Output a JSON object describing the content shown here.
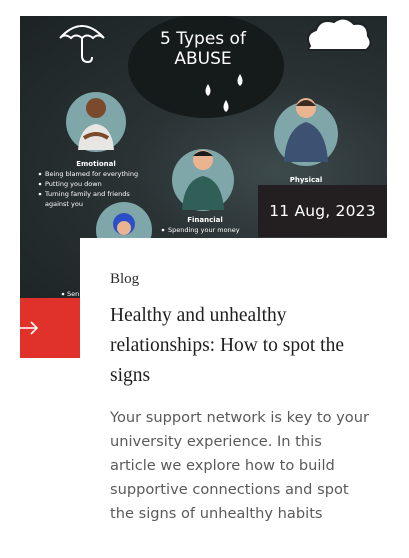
{
  "card": {
    "date": "11 Aug, 2023",
    "category": "Blog",
    "title": "Healthy and unhealthy relationships: How to spot the signs",
    "excerpt": "Your support network is key to your university experience. In this article we explore how to build supportive connections and spot the signs of unhealthy habits",
    "arrow_icon": "arrow-right-icon"
  },
  "infographic": {
    "heading_line1": "5 Types of",
    "heading_line2": "ABUSE",
    "emotional": {
      "label": "Emotional",
      "bullets": [
        "Being blamed for everything",
        "Putting you down",
        "Turning family and friends",
        "against you"
      ]
    },
    "financial": {
      "label": "Financial",
      "bullet": "Spending your money"
    },
    "physical": {
      "label": "Physical"
    },
    "partial_bullet": "Sen"
  },
  "colors": {
    "accent_red": "#e0312b",
    "badge_bg": "#231f20",
    "hero_bg": "#2a3234",
    "circle_teal": "#7fa6a8"
  }
}
